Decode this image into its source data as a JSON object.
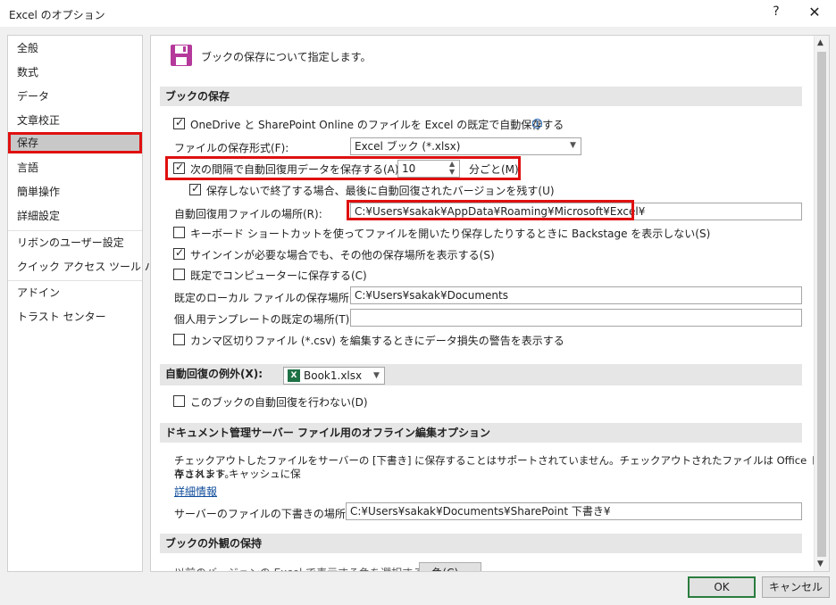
{
  "window": {
    "title": "Excel のオプション",
    "help_icon": "?",
    "close_icon": "✕"
  },
  "sidebar": {
    "items": [
      {
        "label": "全般"
      },
      {
        "label": "数式"
      },
      {
        "label": "データ"
      },
      {
        "label": "文章校正"
      },
      {
        "label": "保存",
        "selected": true
      },
      {
        "label": "言語"
      },
      {
        "label": "簡単操作"
      },
      {
        "label": "詳細設定"
      },
      {
        "label": "リボンのユーザー設定"
      },
      {
        "label": "クイック アクセス ツール バー"
      },
      {
        "label": "アドイン"
      },
      {
        "label": "トラスト センター"
      }
    ]
  },
  "main": {
    "header_text": "ブックの保存について指定します。",
    "section_save": {
      "title": "ブックの保存",
      "onedrive_label": "OneDrive と SharePoint Online のファイルを Excel の既定で自動保存する",
      "onedrive_checked": true,
      "format_label": "ファイルの保存形式(F):",
      "format_value": "Excel ブック (*.xlsx)",
      "autorecover_label": "次の間隔で自動回復用データを保存する(A):",
      "autorecover_checked": true,
      "autorecover_minutes": "10",
      "autorecover_unit": "分ごと(M)",
      "keep_last_label": "保存しないで終了する場合、最後に自動回復されたバージョンを残す(U)",
      "keep_last_checked": true,
      "autorecover_location_label": "自動回復用ファイルの場所(R):",
      "autorecover_location_value": "C:¥Users¥sakak¥AppData¥Roaming¥Microsoft¥Excel¥",
      "backstage_label": "キーボード ショートカットを使ってファイルを開いたり保存したりするときに Backstage を表示しない(S)",
      "backstage_checked": false,
      "signin_label": "サインインが必要な場合でも、その他の保存場所を表示する(S)",
      "signin_checked": true,
      "default_computer_label": "既定でコンピューターに保存する(C)",
      "default_computer_checked": false,
      "local_location_label": "既定のローカル ファイルの保存場所(I):",
      "local_location_value": "C:¥Users¥sakak¥Documents",
      "template_location_label": "個人用テンプレートの既定の場所(T):",
      "template_location_value": "",
      "csv_label": "カンマ区切りファイル (*.csv) を編集するときにデータ損失の警告を表示する",
      "csv_checked": false
    },
    "section_exception": {
      "title": "自動回復の例外(X):",
      "workbook_value": "Book1.xlsx",
      "disable_label": "このブックの自動回復を行わない(D)",
      "disable_checked": false
    },
    "section_offline": {
      "title": "ドキュメント管理サーバー ファイル用のオフライン編集オプション",
      "paragraph_line1": "チェックアウトしたファイルをサーバーの [下書き] に保存することはサポートされていません。チェックアウトされたファイルは Office ドキュメント キャッシュに保",
      "paragraph_line2": "存されます。",
      "details_link": "詳細情報",
      "drafts_label": "サーバーのファイルの下書きの場所(V):",
      "drafts_value": "C:¥Users¥sakak¥Documents¥SharePoint 下書き¥"
    },
    "section_appearance": {
      "title": "ブックの外観の保持",
      "colors_label": "以前のバージョンの Excel で表示する色を選択する:",
      "colors_button": "色(C)..."
    }
  },
  "buttons": {
    "ok": "OK",
    "cancel": "キャンセル"
  },
  "colors": {
    "highlight": "#e01010",
    "ok_border": "#2a7d3f",
    "link": "#0f4c9a",
    "excel_green": "#1e7145"
  }
}
